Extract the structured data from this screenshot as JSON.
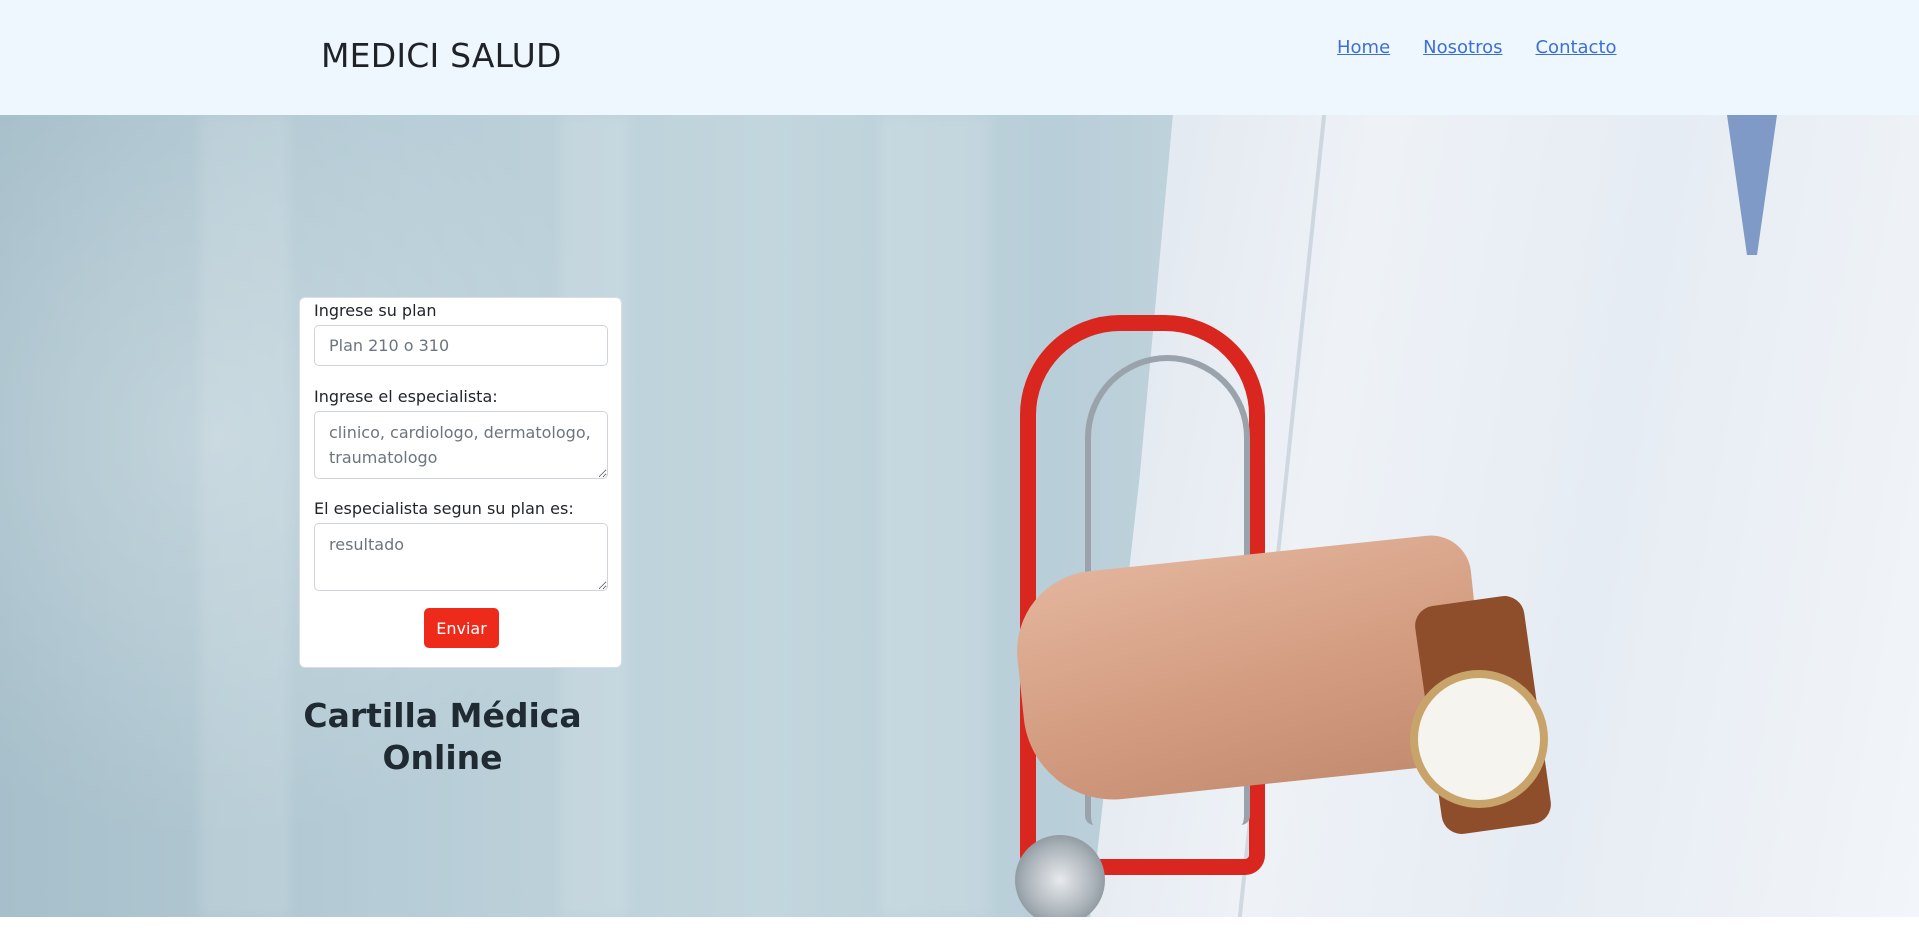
{
  "navbar": {
    "brand": "MEDICI SALUD",
    "links": [
      {
        "label": "Home"
      },
      {
        "label": "Nosotros"
      },
      {
        "label": "Contacto"
      }
    ]
  },
  "form": {
    "plan_label": "Ingrese su plan",
    "plan_placeholder": "Plan 210 o 310",
    "specialist_label": "Ingrese el especialista:",
    "specialist_placeholder": "clinico, cardiologo, dermatologo, traumatologo",
    "result_label": "El especialista segun su plan es:",
    "result_placeholder": "resultado",
    "submit_label": "Enviar"
  },
  "hero": {
    "headline": "Cartilla Médica Online"
  },
  "colors": {
    "navbar_bg": "#eff7fe",
    "link": "#3d6fd6",
    "submit_button": "#ee2a1b"
  }
}
